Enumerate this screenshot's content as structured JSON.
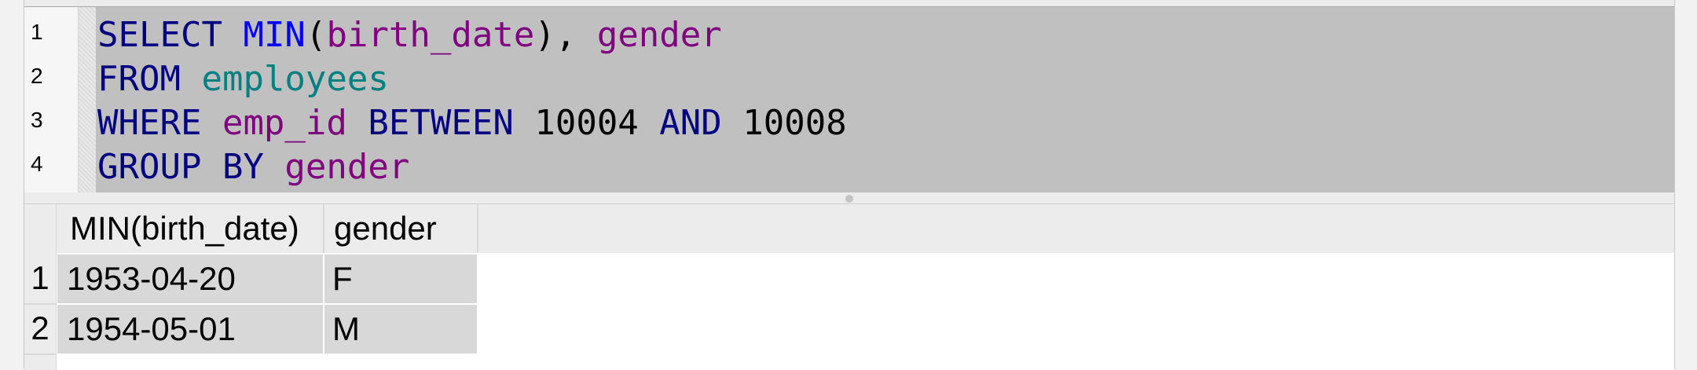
{
  "editor": {
    "line_numbers": [
      "1",
      "2",
      "3",
      "4"
    ],
    "lines": [
      [
        {
          "text": "SELECT",
          "type": "kw"
        },
        {
          "text": " ",
          "type": "plain"
        },
        {
          "text": "MIN",
          "type": "fn"
        },
        {
          "text": "(",
          "type": "plain"
        },
        {
          "text": "birth_date",
          "type": "col"
        },
        {
          "text": "), ",
          "type": "plain"
        },
        {
          "text": "gender",
          "type": "col"
        }
      ],
      [
        {
          "text": "FROM",
          "type": "kw"
        },
        {
          "text": " ",
          "type": "plain"
        },
        {
          "text": "employees",
          "type": "tbl"
        }
      ],
      [
        {
          "text": "WHERE",
          "type": "kw"
        },
        {
          "text": " ",
          "type": "plain"
        },
        {
          "text": "emp_id",
          "type": "col"
        },
        {
          "text": " ",
          "type": "plain"
        },
        {
          "text": "BETWEEN",
          "type": "kw"
        },
        {
          "text": " ",
          "type": "plain"
        },
        {
          "text": "10004",
          "type": "num"
        },
        {
          "text": " ",
          "type": "plain"
        },
        {
          "text": "AND",
          "type": "kw"
        },
        {
          "text": " ",
          "type": "plain"
        },
        {
          "text": "10008",
          "type": "num"
        }
      ],
      [
        {
          "text": "GROUP BY",
          "type": "kw"
        },
        {
          "text": " ",
          "type": "plain"
        },
        {
          "text": "gender",
          "type": "col"
        }
      ]
    ],
    "colors": {
      "keyword": "#000080",
      "function": "#0000ff",
      "column": "#800080",
      "table": "#008080",
      "number": "#000000",
      "selection_bg": "#c0c0c0"
    }
  },
  "results": {
    "columns": [
      "MIN(birth_date)",
      "gender"
    ],
    "rows": [
      {
        "num": "1",
        "cells": [
          "1953-04-20",
          "F"
        ]
      },
      {
        "num": "2",
        "cells": [
          "1954-05-01",
          "M"
        ]
      }
    ]
  }
}
